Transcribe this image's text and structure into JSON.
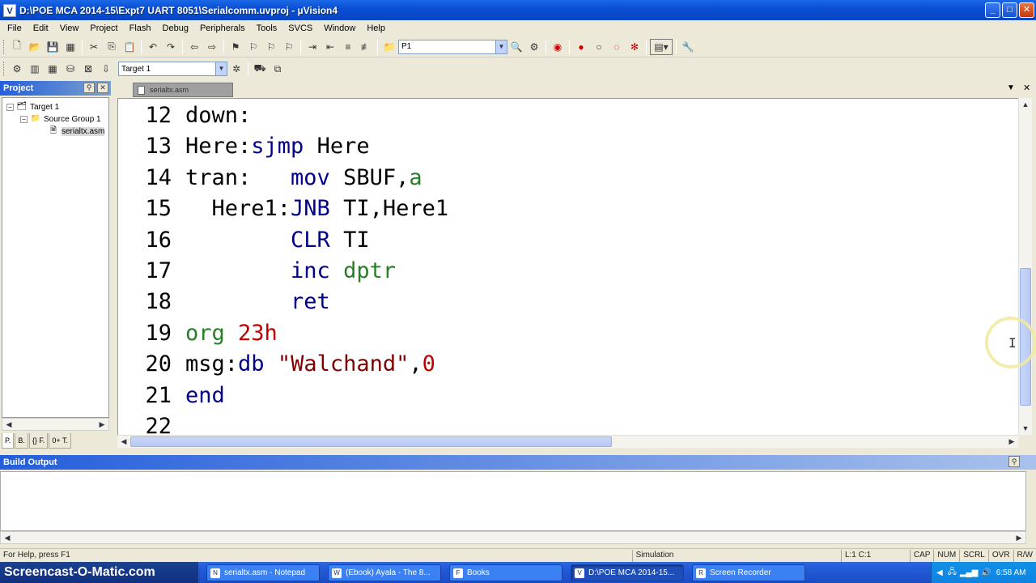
{
  "window": {
    "title": "D:\\POE MCA 2014-15\\Expt7 UART 8051\\Serialcomm.uvproj - µVision4",
    "app_icon": "V",
    "minimize": "_",
    "maximize": "□",
    "close": "✕"
  },
  "menu": [
    "File",
    "Edit",
    "View",
    "Project",
    "Flash",
    "Debug",
    "Peripherals",
    "Tools",
    "SVCS",
    "Window",
    "Help"
  ],
  "toolbar1": {
    "find_combo_value": "P1"
  },
  "toolbar2": {
    "target_combo_value": "Target 1"
  },
  "project_panel": {
    "title": "Project",
    "tree": {
      "target": "Target 1",
      "group": "Source Group 1",
      "file": "serialtx.asm"
    },
    "tabs": [
      "P.",
      "B.",
      "{} F.",
      "0+ T."
    ]
  },
  "editor": {
    "tab_label": "serialtx.asm",
    "lines": [
      {
        "num": "12",
        "segments": [
          {
            "t": "down:",
            "c": "lbl"
          }
        ]
      },
      {
        "num": "13",
        "segments": [
          {
            "t": "Here:",
            "c": "lbl"
          },
          {
            "t": "sjmp",
            "c": "kw"
          },
          {
            "t": " Here",
            "c": "lbl"
          }
        ]
      },
      {
        "num": "14",
        "segments": [
          {
            "t": "tran:   ",
            "c": "lbl"
          },
          {
            "t": "mov",
            "c": "kw"
          },
          {
            "t": " SBUF,",
            "c": "lbl"
          },
          {
            "t": "a",
            "c": "reg"
          }
        ]
      },
      {
        "num": "15",
        "segments": [
          {
            "t": "  Here1:",
            "c": "lbl"
          },
          {
            "t": "JNB",
            "c": "kw"
          },
          {
            "t": " TI,Here1",
            "c": "lbl"
          }
        ]
      },
      {
        "num": "16",
        "segments": [
          {
            "t": "        ",
            "c": "lbl"
          },
          {
            "t": "CLR",
            "c": "kw"
          },
          {
            "t": " TI",
            "c": "lbl"
          }
        ]
      },
      {
        "num": "17",
        "segments": [
          {
            "t": "        ",
            "c": "lbl"
          },
          {
            "t": "inc",
            "c": "kw"
          },
          {
            "t": " ",
            "c": "lbl"
          },
          {
            "t": "dptr",
            "c": "reg"
          }
        ]
      },
      {
        "num": "18",
        "segments": [
          {
            "t": "        ",
            "c": "lbl"
          },
          {
            "t": "ret",
            "c": "kw"
          }
        ]
      },
      {
        "num": "19",
        "segments": [
          {
            "t": "org",
            "c": "reg"
          },
          {
            "t": " ",
            "c": "lbl"
          },
          {
            "t": "23h",
            "c": "num"
          }
        ]
      },
      {
        "num": "20",
        "segments": [
          {
            "t": "msg:",
            "c": "lbl"
          },
          {
            "t": "db",
            "c": "kw"
          },
          {
            "t": " ",
            "c": "lbl"
          },
          {
            "t": "\"Walchand\"",
            "c": "str"
          },
          {
            "t": ",",
            "c": "lbl"
          },
          {
            "t": "0",
            "c": "num"
          }
        ]
      },
      {
        "num": "21",
        "segments": [
          {
            "t": "end",
            "c": "kw"
          }
        ]
      },
      {
        "num": "22",
        "segments": []
      }
    ]
  },
  "build_output": {
    "title": "Build Output"
  },
  "status": {
    "help": "For Help, press F1",
    "mode": "Simulation",
    "position": "L:1 C:1",
    "indicators": [
      "CAP",
      "NUM",
      "SCRL",
      "OVR",
      "R/W"
    ]
  },
  "taskbar": {
    "watermark": "Screencast-O-Matic.com",
    "tasks": [
      {
        "label": "serialtx.asm - Notepad",
        "icon": "N"
      },
      {
        "label": "(Ebook) Ayala - The 8...",
        "icon": "W"
      },
      {
        "label": "Books",
        "icon": "F"
      },
      {
        "label": "D:\\POE MCA 2014-15...",
        "icon": "V"
      },
      {
        "label": "Screen Recorder",
        "icon": "R"
      }
    ],
    "clock": "6:58 AM"
  }
}
